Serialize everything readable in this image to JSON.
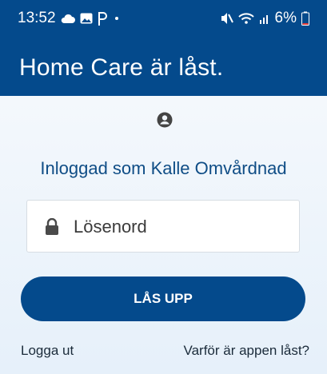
{
  "status_bar": {
    "time": "13:52",
    "left_icons": [
      "cloud-icon",
      "image-icon",
      "p-icon",
      "dot-icon"
    ],
    "right_icons": [
      "mute-icon",
      "wifi-icon",
      "signal-icon"
    ],
    "battery": "6%"
  },
  "app_bar": {
    "title": "Home Care är låst."
  },
  "lock_screen": {
    "logged_in_text": "Inloggad som Kalle Omvårdnad",
    "password_placeholder": "Lösenord",
    "unlock_button_label": "LÅS UPP",
    "logout_link": "Logga ut",
    "why_locked_link": "Varför är appen låst?"
  },
  "colors": {
    "primary": "#044a8c",
    "background": "#e8f1fa",
    "text": "#0f4d86"
  }
}
